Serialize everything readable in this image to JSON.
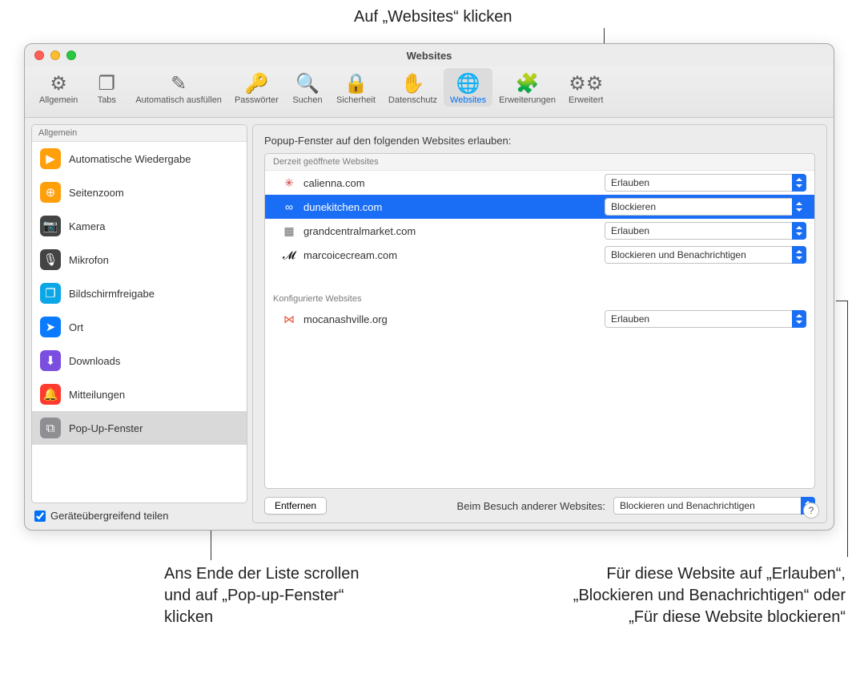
{
  "callouts": {
    "top": "Auf „Websites“ klicken",
    "left": "Ans Ende der Liste scrollen und auf „Pop-up-Fenster“ klicken",
    "right": "Für diese Website auf „Erlauben“, „Blockieren und Benachrichtigen“ oder „Für diese Website blockieren“"
  },
  "window": {
    "title": "Websites"
  },
  "toolbar": {
    "items": [
      {
        "label": "Allgemein",
        "glyph": "⚙︎"
      },
      {
        "label": "Tabs",
        "glyph": "❐"
      },
      {
        "label": "Automatisch ausfüllen",
        "glyph": "✎"
      },
      {
        "label": "Passwörter",
        "glyph": "🔑"
      },
      {
        "label": "Suchen",
        "glyph": "🔍"
      },
      {
        "label": "Sicherheit",
        "glyph": "🔒"
      },
      {
        "label": "Datenschutz",
        "glyph": "✋"
      },
      {
        "label": "Websites",
        "glyph": "🌐"
      },
      {
        "label": "Erweiterungen",
        "glyph": "🧩"
      },
      {
        "label": "Erweitert",
        "glyph": "⚙︎⚙︎"
      }
    ],
    "active_index": 7
  },
  "sidebar": {
    "header": "Allgemein",
    "items": [
      {
        "label": "Automatische Wiedergabe",
        "icon": "▶",
        "bg": "#ff9f0a"
      },
      {
        "label": "Seitenzoom",
        "icon": "⊕",
        "bg": "#ff9f0a"
      },
      {
        "label": "Kamera",
        "icon": "📷",
        "bg": "#444"
      },
      {
        "label": "Mikrofon",
        "icon": "🎙",
        "bg": "#444"
      },
      {
        "label": "Bildschirmfreigabe",
        "icon": "❐",
        "bg": "#0aa6e6"
      },
      {
        "label": "Ort",
        "icon": "➤",
        "bg": "#0a7bff"
      },
      {
        "label": "Downloads",
        "icon": "⬇",
        "bg": "#7a4fe0"
      },
      {
        "label": "Mitteilungen",
        "icon": "🔔",
        "bg": "#ff3b30"
      },
      {
        "label": "Pop-Up-Fenster",
        "icon": "⧉",
        "bg": "#8e8e93"
      }
    ],
    "selected_index": 8,
    "share_label": "Geräteübergreifend teilen"
  },
  "main": {
    "heading": "Popup-Fenster auf den folgenden Websites erlauben:",
    "group1": "Derzeit geöffnete Websites",
    "group2": "Konfigurierte Websites",
    "open_sites": [
      {
        "name": "calienna.com",
        "fav": "✳",
        "favcolor": "#d23a3a",
        "value": "Erlauben"
      },
      {
        "name": "dunekitchen.com",
        "fav": "∞",
        "favcolor": "#ffffff",
        "value": "Blockieren",
        "selected": true
      },
      {
        "name": "grandcentralmarket.com",
        "fav": "▦",
        "favcolor": "#6b6b6b",
        "value": "Erlauben"
      },
      {
        "name": "marcoicecream.com",
        "fav": "𝓜",
        "favcolor": "#000",
        "value": "Blockieren und Benachrichtigen"
      }
    ],
    "conf_sites": [
      {
        "name": "mocanashville.org",
        "fav": "⋈",
        "favcolor": "#e6533c",
        "value": "Erlauben"
      }
    ],
    "remove_btn": "Entfernen",
    "other_label": "Beim Besuch anderer Websites:",
    "other_value": "Blockieren und Benachrichtigen",
    "help": "?"
  }
}
